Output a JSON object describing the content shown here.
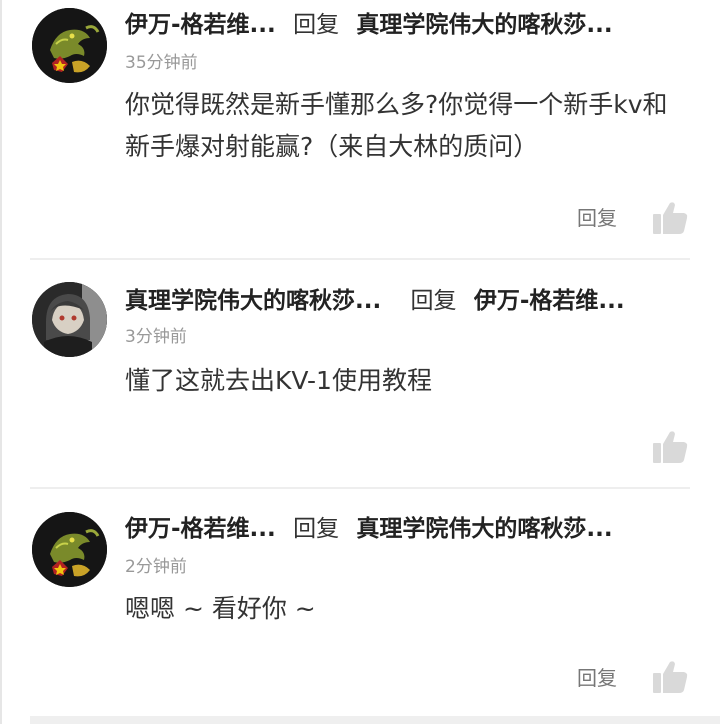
{
  "comments": [
    {
      "author": "伊万-格若维...",
      "reply_word": "回复",
      "reply_to": "真理学院伟大的喀秋莎...",
      "time": "35分钟前",
      "text": "你觉得既然是新手懂那么多?你觉得一个新手kv和新手爆对射能赢?（来自大林的质问）",
      "reply_button": "回复",
      "avatar_icon": "dragon-avatar-icon"
    },
    {
      "author": "真理学院伟大的喀秋莎...",
      "reply_word": "回复",
      "reply_to": "伊万-格若维...",
      "time": "3分钟前",
      "text": "懂了这就去出KV-1使用教程",
      "reply_button": "",
      "avatar_icon": "anime-girl-avatar-icon"
    },
    {
      "author": "伊万-格若维...",
      "reply_word": "回复",
      "reply_to": "真理学院伟大的喀秋莎...",
      "time": "2分钟前",
      "text": "嗯嗯 ~ 看好你 ~",
      "reply_button": "回复",
      "avatar_icon": "dragon-avatar-icon"
    }
  ],
  "icons": {
    "like": "thumbs-up-icon"
  },
  "colors": {
    "name": "#222222",
    "time": "#999999",
    "body": "#333333",
    "icon": "#d9d9d9"
  }
}
